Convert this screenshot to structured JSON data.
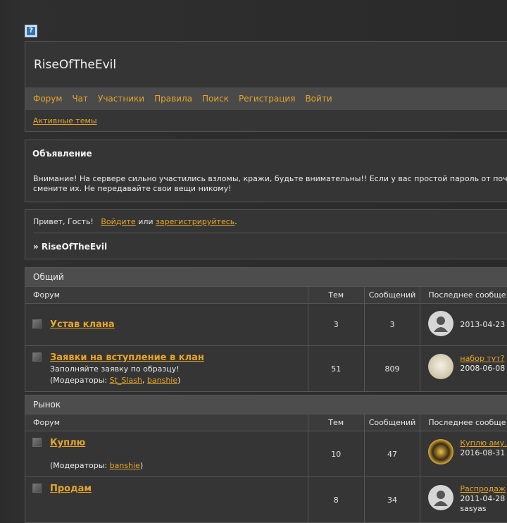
{
  "help_icon": "?",
  "site": {
    "title": "RiseOfTheEvil"
  },
  "nav": [
    "Форум",
    "Чат",
    "Участники",
    "Правила",
    "Поиск",
    "Регистрация",
    "Войти"
  ],
  "subnav": {
    "active_topics": "Активные темы"
  },
  "announcement": {
    "title": "Объявление",
    "line1": "Внимание! На сервере сильно участились взломы, кражи, будьте внимательны!! Если у вас простой пароль от поч",
    "line2": "смените их. Не передавайте свои вещи никому!"
  },
  "welcome": {
    "greeting": "Привет, Гость!",
    "login": "Войдите",
    "or": "или",
    "register": "зарегистрируйтесь",
    "crumb": "» RiseOfTheEvil"
  },
  "columns": {
    "forum": "Форум",
    "topics": "Тем",
    "posts": "Сообщений",
    "last": "Последнее сообще"
  },
  "categories": [
    {
      "name": "Общий",
      "forums": [
        {
          "title": "Устав клана",
          "topics": "3",
          "posts": "3",
          "last_date": "2013-04-23"
        },
        {
          "title": "Заявки на вступление в клан",
          "desc": "Заполняйте заявку по образцу!",
          "moderators_label": "(Модераторы:",
          "mod1": "St_Slash",
          "mod2": "banshie",
          "close": ")",
          "topics": "51",
          "posts": "809",
          "last_link": "набор тут?",
          "last_date": "2008-06-08"
        }
      ]
    },
    {
      "name": "Рынок",
      "forums": [
        {
          "title": "Куплю",
          "moderators_label": "(Модераторы:",
          "mod1": "banshie",
          "close": ")",
          "topics": "10",
          "posts": "47",
          "last_link": "Куплю аму.",
          "last_date": "2016-08-31"
        },
        {
          "title": "Продам",
          "topics": "8",
          "posts": "34",
          "last_link": "Распродаж",
          "last_date": "2011-04-28",
          "last_user": "sasyas"
        }
      ]
    }
  ]
}
